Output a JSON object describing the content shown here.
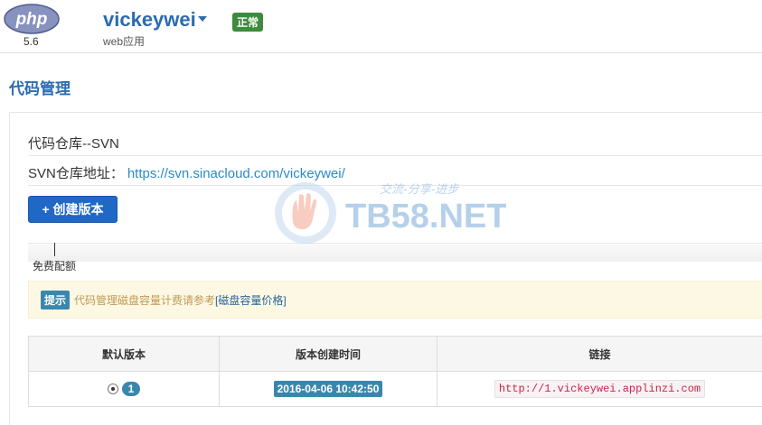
{
  "header": {
    "runtime_logo_text": "php",
    "runtime_version": "5.6",
    "app_name": "vickeywei",
    "app_type": "web应用",
    "status": "正常"
  },
  "page_title": "代码管理",
  "repo": {
    "title": "代码仓库--SVN",
    "address_label": "SVN仓库地址：",
    "address_url": "https://svn.sinacloud.com/vickeywei/"
  },
  "create_button_label": "+ 创建版本",
  "quota": {
    "label": "免费配额"
  },
  "tip": {
    "label": "提示",
    "text": "代码管理磁盘容量计费请参考",
    "link_text": "[磁盘容量价格]"
  },
  "table": {
    "headers": [
      "默认版本",
      "版本创建时间",
      "链接"
    ],
    "rows": [
      {
        "version": "1",
        "created": "2016-04-06 10:42:50",
        "link": "http://1.vickeywei.applinzi.com"
      }
    ]
  },
  "watermark": {
    "brand": "TB58.NET",
    "slogan": "交流-分享-进步"
  },
  "colors": {
    "accent": "#2b6bb1",
    "button": "#1f68c6",
    "success": "#3d8b3d",
    "info": "#3a87ad",
    "warning_bg": "#fcf8e3"
  }
}
